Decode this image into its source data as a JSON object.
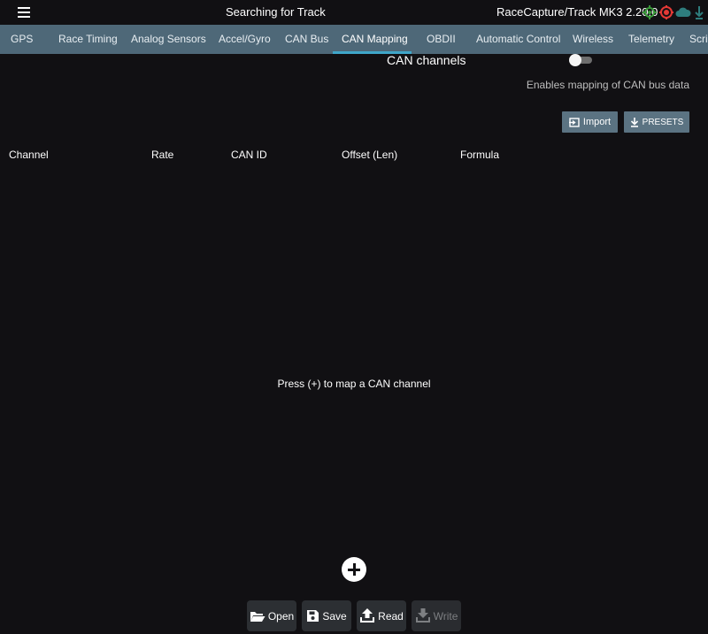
{
  "topbar": {
    "title": "Searching for Track",
    "app_version": "RaceCapture/Track MK3 2.20.0",
    "status_icons": [
      "gps-status-icon",
      "logging-status-icon",
      "cloud-status-icon",
      "telemetry-status-icon"
    ],
    "status_colors": [
      "#3a9a3a",
      "#e53935",
      "#2e7d7d",
      "#2e7d7d"
    ]
  },
  "tabs": [
    {
      "label": "GPS"
    },
    {
      "label": "Race Timing"
    },
    {
      "label": "Analog Sensors"
    },
    {
      "label": "Accel/Gyro"
    },
    {
      "label": "CAN Bus"
    },
    {
      "label": "CAN Mapping"
    },
    {
      "label": "OBDII"
    },
    {
      "label": "Automatic Control"
    },
    {
      "label": "Wireless"
    },
    {
      "label": "Telemetry"
    },
    {
      "label": "Scri"
    }
  ],
  "active_tab": "CAN Mapping",
  "can_channels": {
    "label": "CAN channels",
    "description": "Enables mapping of CAN bus data",
    "enabled": false
  },
  "buttons": {
    "import_label": "Import",
    "presets_label": "PRESETS"
  },
  "table": {
    "headers": [
      "Channel",
      "Rate",
      "CAN ID",
      "Offset (Len)",
      "Formula"
    ]
  },
  "empty_hint": "Press (+) to map a CAN channel",
  "bottom_buttons": {
    "open_label": "Open",
    "save_label": "Save",
    "read_label": "Read",
    "write_label": "Write"
  },
  "colors": {
    "tabbar": "#4e6878",
    "tab_indicator": "#3fa6c9",
    "button": "#5b7382",
    "background": "#111013"
  }
}
